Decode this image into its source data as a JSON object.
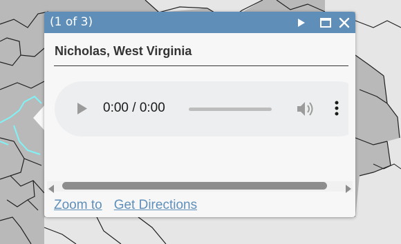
{
  "popup": {
    "title_count": "(1 of 3)",
    "header": "Nicholas, West Virginia",
    "audio": {
      "time": "0:00 / 0:00",
      "progress": 0
    },
    "actions": [
      {
        "label": "Zoom to"
      },
      {
        "label": "Get Directions"
      }
    ],
    "buttons": {
      "next": "next-feature",
      "maximize": "maximize-window",
      "close": "close-popup"
    }
  },
  "colors": {
    "accent": "#5f8fb9",
    "highlight": "#7ff3f6",
    "map_land": "#b9b9b9",
    "map_background": "#e6e6e6"
  }
}
